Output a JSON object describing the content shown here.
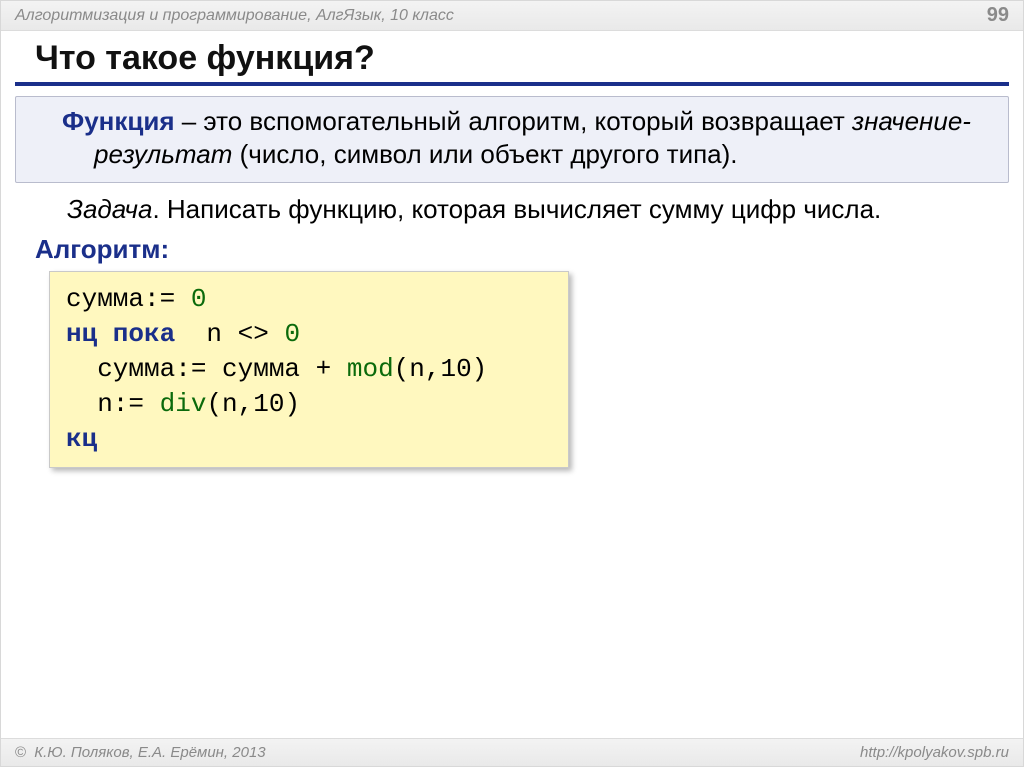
{
  "header": {
    "subject": "Алгоритмизация и программирование, АлгЯзык, 10 класс",
    "page": "99"
  },
  "title": "Что такое функция?",
  "definition": {
    "term": "Функция",
    "rest1": " – это вспомогательный алгоритм, который возвращает ",
    "em": "значение-результат",
    "rest2": " (число, символ или объект другого типа)."
  },
  "task": {
    "lead": "Задача",
    "text": ". Написать функцию, которая вычисляет сумму цифр числа."
  },
  "algo_label": "Алгоритм:",
  "code": {
    "l1_a": "сумма:=",
    "l1_b": " 0",
    "l2_a": "нц пока",
    "l2_b": "  n <> ",
    "l2_c": "0",
    "l3_a": "  сумма:= сумма + ",
    "l3_b": "mod",
    "l3_c": "(n,10)",
    "l4_a": "  n:= ",
    "l4_b": "div",
    "l4_c": "(n,10)",
    "l5": "кц"
  },
  "footer": {
    "copyright": " К.Ю. Поляков, Е.А. Ерёмин, 2013",
    "url": "http://kpolyakov.spb.ru"
  }
}
